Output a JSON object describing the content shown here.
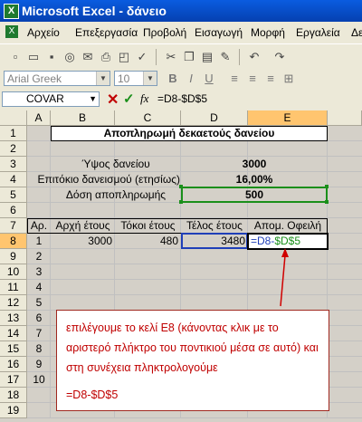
{
  "window": {
    "title": "Microsoft Excel - δάνειο",
    "app_icon": "X"
  },
  "menu": {
    "items": [
      {
        "label": "Αρχείο"
      },
      {
        "label": "Επεξεργασία"
      },
      {
        "label": "Προβολή"
      },
      {
        "label": "Εισαγωγή"
      },
      {
        "label": "Μορφή"
      },
      {
        "label": "Εργαλεία"
      },
      {
        "label": "Δεδ"
      }
    ]
  },
  "toolbar": {
    "icons": [
      "new-icon",
      "open-icon",
      "save-icon",
      "permission-icon",
      "email-icon",
      "print-icon",
      "print-preview-icon",
      "spelling-icon",
      "cut-icon",
      "copy-icon",
      "paste-icon",
      "format-painter-icon",
      "undo-icon",
      "redo-icon"
    ]
  },
  "format_toolbar": {
    "font": "Arial Greek",
    "size": "10",
    "bold": "B",
    "italic": "I",
    "underline": "U"
  },
  "formula_bar": {
    "name_box": "COVAR",
    "cancel": "✕",
    "enter": "✓",
    "fx": "fx",
    "formula": "=D8-$D$5"
  },
  "sheet": {
    "columns": [
      "A",
      "B",
      "C",
      "D",
      "E"
    ],
    "rows": [
      "1",
      "2",
      "3",
      "4",
      "5",
      "6",
      "7",
      "8",
      "9",
      "10",
      "11",
      "12",
      "13",
      "14",
      "15",
      "16",
      "17",
      "18",
      "19"
    ],
    "title": "Αποπληρωμή δεκαετούς δανείου",
    "labels": {
      "amount": "Ύψος δανείου",
      "rate": "Επιτόκιο δανεισμού (ετησίως)",
      "payment": "Δόση αποπληρωμής"
    },
    "values": {
      "amount": "3000",
      "rate": "16,00%",
      "payment": "500"
    },
    "headers": [
      "Αρ.",
      "Αρχή έτους",
      "Τόκοι έτους",
      "Τέλος έτους",
      "Απομ. Οφειλή"
    ],
    "row8": {
      "n": "1",
      "start": "3000",
      "interest": "480",
      "end": "3480"
    },
    "edit_formula_prefix": "=D8-",
    "edit_formula_ref": "$D$5",
    "numbers": [
      "2",
      "3",
      "4",
      "5",
      "6",
      "7",
      "8",
      "9",
      "10"
    ]
  },
  "callout": {
    "text": "επιλέγουμε το κελί Ε8 (κάνοντας κλικ με το αριστερό πλήκτρο του ποντικιού μέσα σε αυτό) και στη συνέχεια πληκτρολογούμε",
    "formula": "=D8-$D$5"
  },
  "colors": {
    "accent_red": "#c00000",
    "ref_green": "#1a8f1a",
    "ref_blue": "#1f3fb8"
  }
}
